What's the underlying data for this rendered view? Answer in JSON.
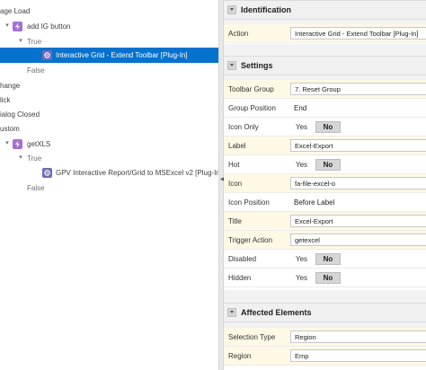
{
  "tree": {
    "nodes": [
      {
        "label": "age Load",
        "indent": 0,
        "kind": "event"
      },
      {
        "label": "add IG button",
        "indent": 1,
        "kind": "dynamic-action"
      },
      {
        "label": "True",
        "indent": 2,
        "kind": "branch"
      },
      {
        "label": "Interactive Grid - Extend Toolbar [Plug-In]",
        "indent": 3,
        "kind": "plugin-action",
        "selected": true
      },
      {
        "label": "False",
        "indent": 2,
        "kind": "branch-leaf"
      },
      {
        "label": "hange",
        "indent": 0,
        "kind": "event"
      },
      {
        "label": "lick",
        "indent": 0,
        "kind": "event"
      },
      {
        "label": "ialog Closed",
        "indent": 0,
        "kind": "event"
      },
      {
        "label": "ustom",
        "indent": 0,
        "kind": "event"
      },
      {
        "label": "getXLS",
        "indent": 1,
        "kind": "dynamic-action"
      },
      {
        "label": "True",
        "indent": 2,
        "kind": "branch"
      },
      {
        "label": "GPV Interactive Report/Grid to MSExcel v2 [Plug-In]",
        "indent": 3,
        "kind": "plugin-action"
      },
      {
        "label": "False",
        "indent": 2,
        "kind": "branch-leaf"
      }
    ]
  },
  "props": {
    "identification": {
      "title": "Identification",
      "action_label": "Action",
      "action_value": "Interactive Grid - Extend Toolbar [Plug-In]"
    },
    "settings": {
      "title": "Settings",
      "toolbar_group_label": "Toolbar Group",
      "toolbar_group_value": "7. Reset Group",
      "group_position_label": "Group Position",
      "group_position_value": "End",
      "icon_only_label": "Icon Only",
      "label_label": "Label",
      "label_value": "Excel-Export",
      "hot_label": "Hot",
      "icon_label": "Icon",
      "icon_value": "fa-file-excel-o",
      "icon_position_label": "Icon Position",
      "icon_position_value": "Before Label",
      "title_label": "Title",
      "title_value": "Excel-Export",
      "trigger_action_label": "Trigger Action",
      "trigger_action_value": "getexcel",
      "disabled_label": "Disabled",
      "hidden_label": "Hidden",
      "yes": "Yes",
      "no": "No"
    },
    "affected": {
      "title": "Affected Elements",
      "selection_type_label": "Selection Type",
      "selection_type_value": "Region",
      "region_label": "Region",
      "region_value": "Emp"
    }
  },
  "colors": {
    "selection": "#0572ce",
    "dynamic_action_icon": "#a66ed6",
    "required_row": "#fff8e5"
  }
}
